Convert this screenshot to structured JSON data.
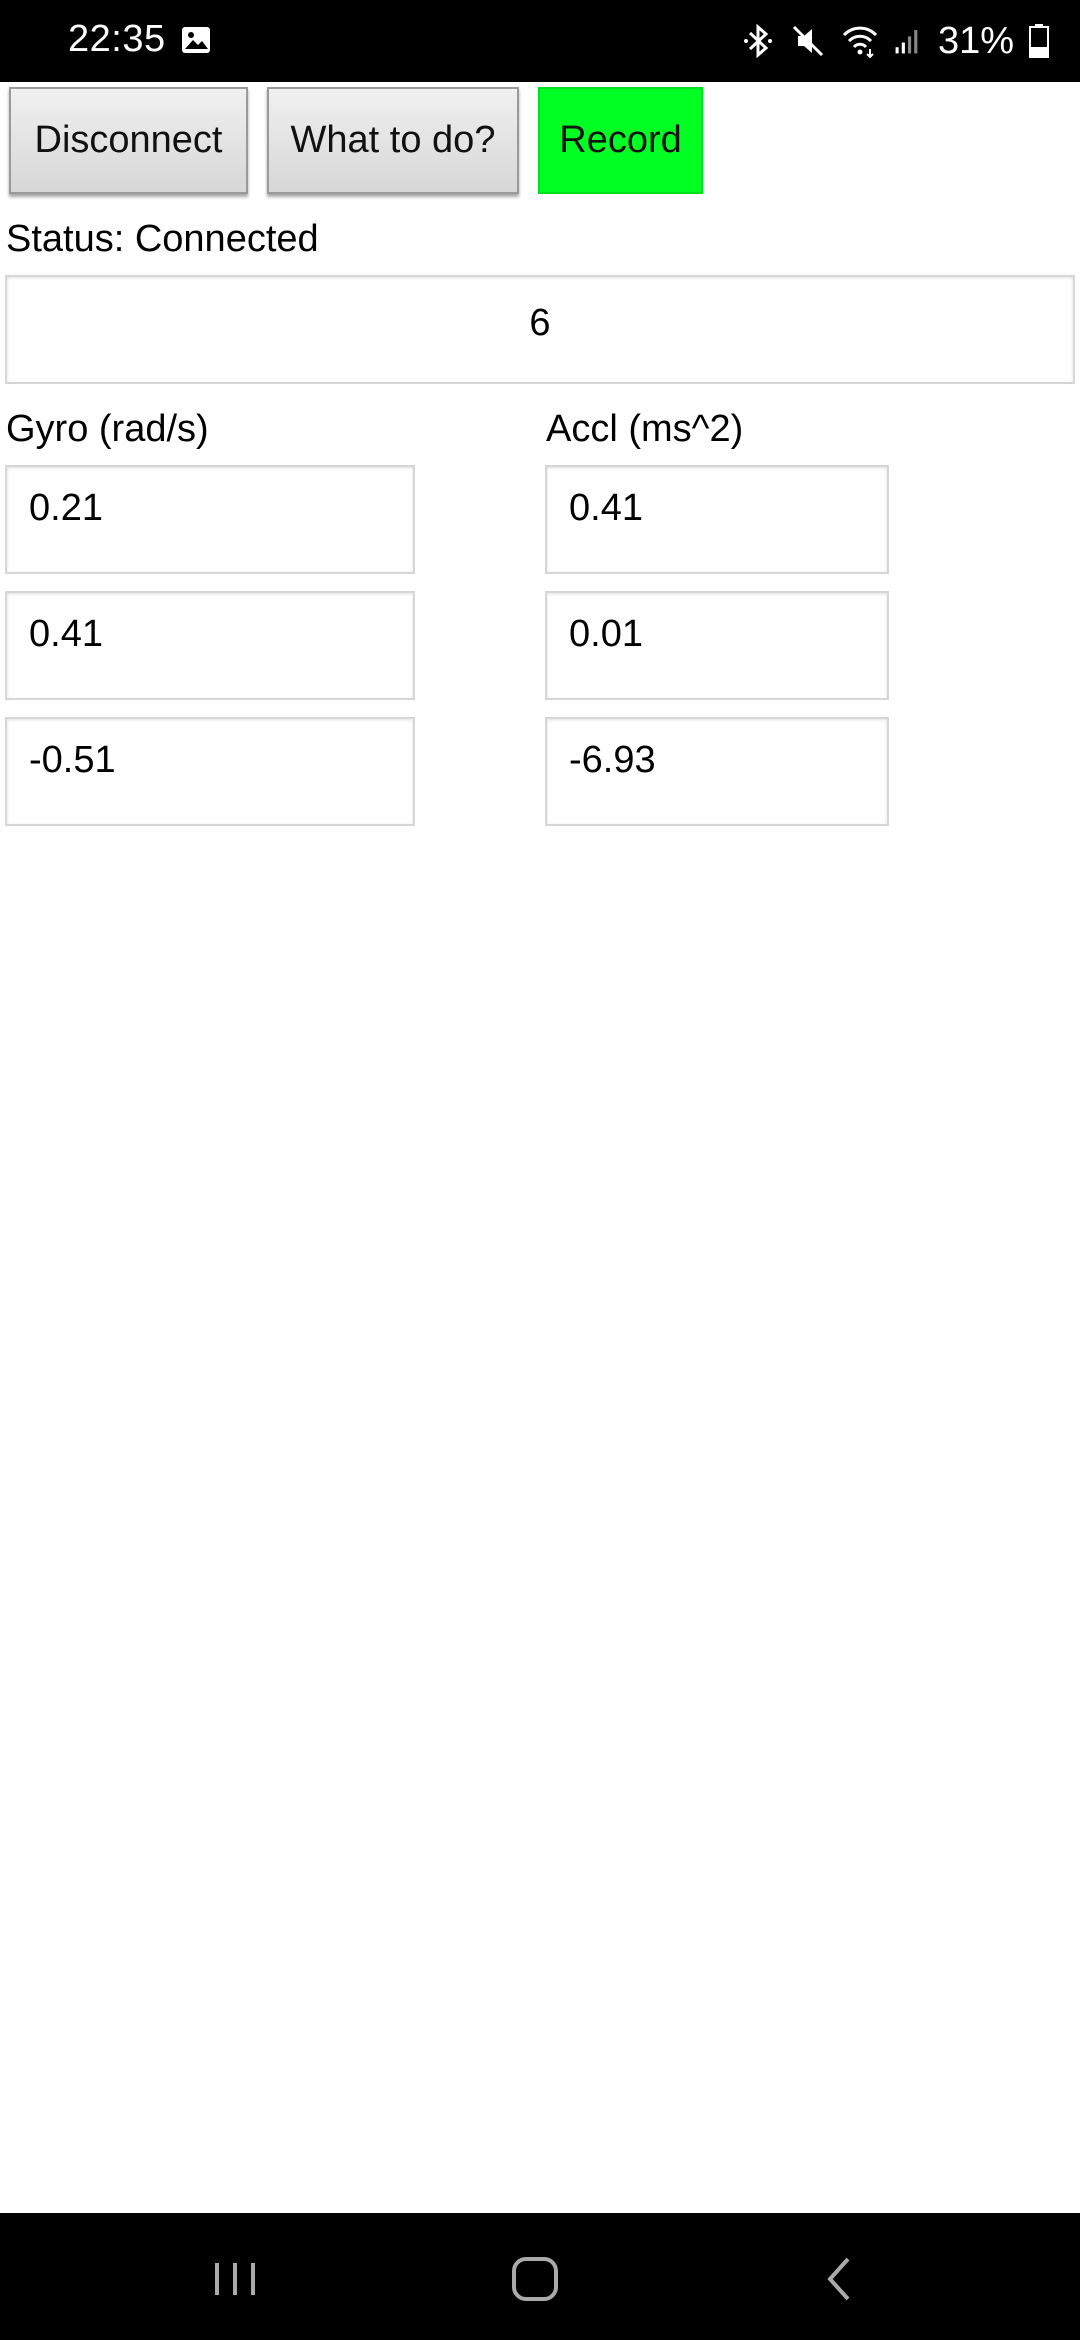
{
  "status_bar": {
    "time": "22:35",
    "battery_percent": "31%",
    "icons": [
      "gallery-icon",
      "bluetooth-icon",
      "mute-icon",
      "wifi-icon",
      "signal-icon",
      "battery-icon"
    ]
  },
  "toolbar": {
    "disconnect_label": "Disconnect",
    "what_to_do_label": "What to do?",
    "record_label": "Record",
    "record_color": "#00ff23"
  },
  "status": {
    "label": "Status: Connected",
    "counter_value": "6"
  },
  "gyro": {
    "label": "Gyro (rad/s)",
    "values": [
      "0.21",
      "0.41",
      "-0.51"
    ]
  },
  "accl": {
    "label": "Accl (ms^2)",
    "values": [
      "0.41",
      "0.01",
      "-6.93"
    ]
  },
  "nav_bar": {
    "icons": [
      "recents-icon",
      "home-icon",
      "back-icon"
    ]
  }
}
